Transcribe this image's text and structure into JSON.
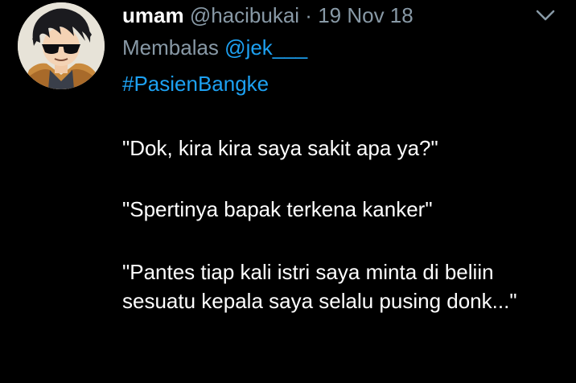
{
  "tweet": {
    "display_name": "umam",
    "handle": "@hacibukai",
    "separator": "·",
    "timestamp": "19 Nov 18",
    "reply_label": "Membalas",
    "reply_mention": "@jek___",
    "hashtag": "#PasienBangke",
    "paragraphs": [
      "\"Dok, kira kira saya sakit apa ya?\"",
      "\"Spertinya bapak terkena kanker\"",
      "\"Pantes tiap kali istri saya minta di beliin sesuatu kepala saya selalu pusing donk...\""
    ]
  },
  "icons": {
    "avatar": "anime-character-with-sunglasses-avatar",
    "menu": "chevron-down-icon"
  },
  "colors": {
    "background": "#000000",
    "text": "#ffffff",
    "muted": "#8899a6",
    "link": "#1da1f2"
  }
}
